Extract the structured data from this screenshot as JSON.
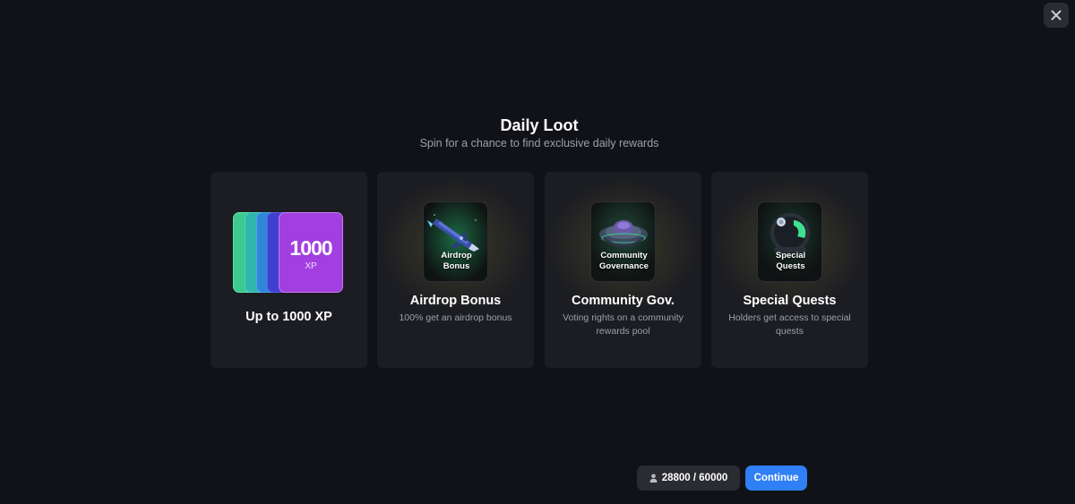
{
  "modal": {
    "close_icon": "close-icon",
    "title": "Daily Loot",
    "subtitle": "Spin for a chance to find exclusive daily rewards"
  },
  "cards": [
    {
      "id": "xp",
      "badge_value": "1000",
      "badge_unit": "XP",
      "title": "Up to 1000 XP",
      "colors": [
        "#3ec98d",
        "#2fb6ad",
        "#2f86d8",
        "#3f3fd0",
        "#a23fe0"
      ]
    },
    {
      "id": "airdrop",
      "image_label": "Airdrop Bonus",
      "image_label_line1": "Airdrop",
      "image_label_line2": "Bonus",
      "icon": "rocket-icon",
      "title": "Airdrop Bonus",
      "description": "100% get an airdrop bonus"
    },
    {
      "id": "governance",
      "image_label_line1": "Community",
      "image_label_line2": "Governance",
      "icon": "ufo-icon",
      "title": "Community Gov.",
      "description": "Voting rights on a community rewards pool"
    },
    {
      "id": "quests",
      "image_label_line1": "Special",
      "image_label_line2": "Quests",
      "icon": "helmet-icon",
      "title": "Special Quests",
      "description": "Holders get access to special quests"
    }
  ],
  "footer": {
    "counter_icon": "user-icon",
    "counter_text": "28800 / 60000",
    "continue_label": "Continue",
    "accent_color": "#2f7ff6"
  }
}
